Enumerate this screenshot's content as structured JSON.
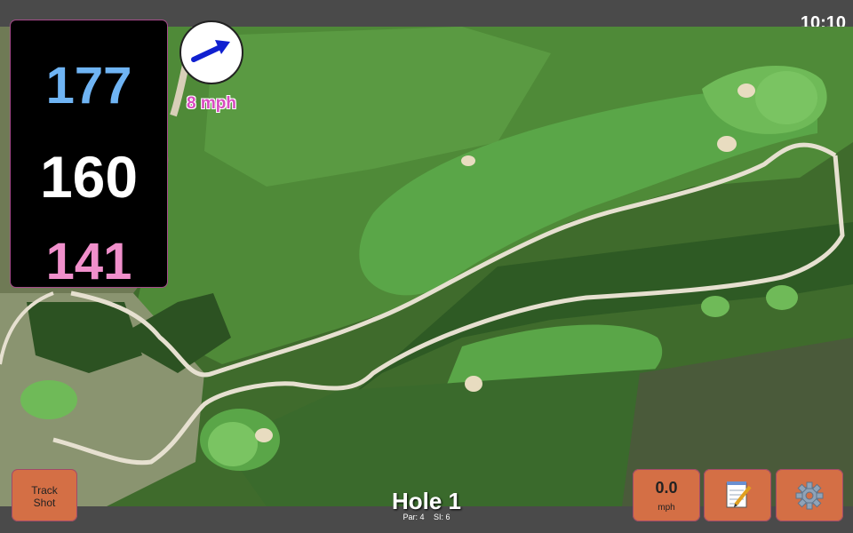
{
  "status": {
    "time": "10:10"
  },
  "distances": {
    "back": "177",
    "middle": "160",
    "front": "141"
  },
  "wind": {
    "speed_label": "8 mph",
    "icon": "wind-arrow-icon"
  },
  "buttons": {
    "track_shot": {
      "line1": "Track",
      "line2": "Shot"
    },
    "speed": {
      "value": "0.0",
      "unit": "mph"
    },
    "notes": {
      "icon": "notepad-icon"
    },
    "settings": {
      "icon": "gear-icon"
    }
  },
  "hole": {
    "title": "Hole 1",
    "par": "Par: 4",
    "si": "SI: 6"
  },
  "colors": {
    "distance_back": "#6fb4f4",
    "distance_middle": "#ffffff",
    "distance_front": "#f08fcb",
    "button": "#d46f45",
    "wind_text": "#d84cc0",
    "wind_arrow": "#1020d0"
  }
}
